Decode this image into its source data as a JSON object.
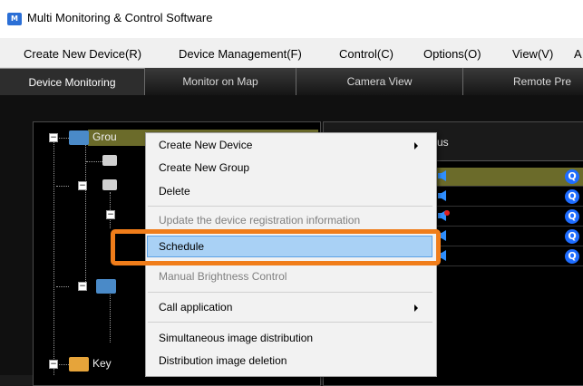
{
  "window": {
    "title": "Multi Monitoring & Control Software"
  },
  "menubar": {
    "items": [
      {
        "label": "Create New Device(R)"
      },
      {
        "label": "Device Management(F)"
      },
      {
        "label": "Control(C)"
      },
      {
        "label": "Options(O)"
      },
      {
        "label": "View(V)"
      },
      {
        "label": "A"
      }
    ]
  },
  "tabs": [
    {
      "label": "Device Monitoring",
      "active": true
    },
    {
      "label": "Monitor on Map"
    },
    {
      "label": "Camera View"
    },
    {
      "label": "Remote Pre"
    }
  ],
  "tree": {
    "group_label": "Grou",
    "keyword_label": "Key"
  },
  "list": {
    "status_header": "us"
  },
  "context_menu": {
    "items": [
      {
        "label": "Create New Device",
        "submenu": true
      },
      {
        "label": "Create New Group"
      },
      {
        "label": "Delete"
      },
      {
        "label": "Update the device registration information",
        "disabled": true
      },
      {
        "label": "Schedule",
        "highlighted": true
      },
      {
        "label": "Manual Brightness Control",
        "disabled": true
      },
      {
        "label": "Call application",
        "submenu": true
      },
      {
        "label": "Simultaneous image distribution"
      },
      {
        "label": "Distribution image deletion"
      }
    ]
  },
  "colors": {
    "highlight": "#a9d1f5",
    "callout": "#f07d1a",
    "selected_row": "#6b6b2a",
    "search_button": "#1e6cff"
  },
  "icons": {
    "app": "app-icon",
    "speaker": "speaker-icon",
    "speaker_muted": "speaker-muted-icon",
    "search": "search-icon",
    "folder": "folder-icon"
  }
}
